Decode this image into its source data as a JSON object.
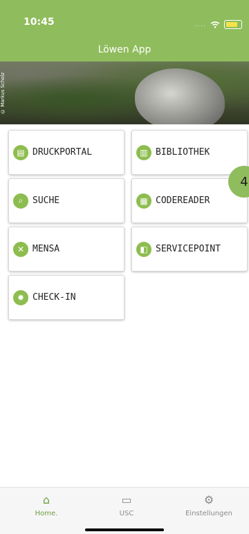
{
  "status": {
    "time": "10:45",
    "battery_color": "#f5e34a"
  },
  "app": {
    "title": "Löwen App",
    "brand_color": "#8fbc5c"
  },
  "banner": {
    "credit": "© Markus Scholz"
  },
  "tiles": [
    {
      "label": "DRUCKPORTAL",
      "icon": "printer-icon"
    },
    {
      "label": "BIBLIOTHEK",
      "icon": "library-icon"
    },
    {
      "label": "SUCHE",
      "icon": "search-icon"
    },
    {
      "label": "CODEREADER",
      "icon": "qr-code-icon"
    },
    {
      "label": "MENSA",
      "icon": "cutlery-icon"
    },
    {
      "label": "SERVICEPOINT",
      "icon": "service-icon"
    },
    {
      "label": "CHECK-IN",
      "icon": "virus-icon"
    }
  ],
  "floating": {
    "label": "4"
  },
  "tabbar": {
    "items": [
      {
        "label": "Home.",
        "icon": "home-icon",
        "active": true
      },
      {
        "label": "USC",
        "icon": "card-icon",
        "active": false
      },
      {
        "label": "Einstellungen",
        "icon": "gear-icon",
        "active": false
      }
    ]
  }
}
